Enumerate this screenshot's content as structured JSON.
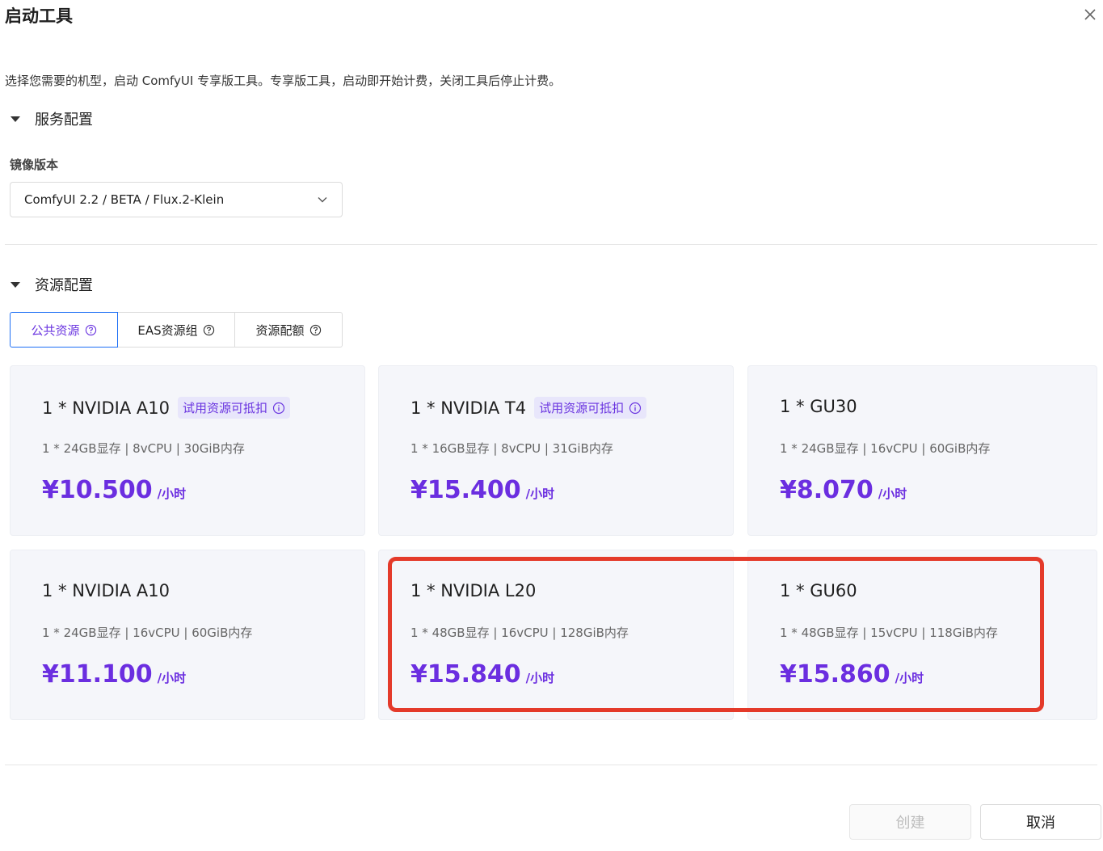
{
  "dialog": {
    "title": "启动工具",
    "description": "选择您需要的机型，启动 ComfyUI 专享版工具。专享版工具，启动即开始计费，关闭工具后停止计费。"
  },
  "service_config": {
    "header": "服务配置",
    "image_version_label": "镜像版本",
    "image_version_value": "ComfyUI 2.2 / BETA / Flux.2-Klein"
  },
  "resource_config": {
    "header": "资源配置",
    "tabs": [
      {
        "label": "公共资源",
        "active": true
      },
      {
        "label": "EAS资源组",
        "active": false
      },
      {
        "label": "资源配额",
        "active": false
      }
    ],
    "cards": [
      {
        "name": "1 * NVIDIA A10",
        "tag": "试用资源可抵扣",
        "spec": "1 * 24GB显存 | 8vCPU | 30GiB内存",
        "price": "¥10.500",
        "unit": "/小时"
      },
      {
        "name": "1 * NVIDIA T4",
        "tag": "试用资源可抵扣",
        "spec": "1 * 16GB显存 | 8vCPU | 31GiB内存",
        "price": "¥15.400",
        "unit": "/小时"
      },
      {
        "name": "1 * GU30",
        "tag": "",
        "spec": "1 * 24GB显存 | 16vCPU | 60GiB内存",
        "price": "¥8.070",
        "unit": "/小时"
      },
      {
        "name": "1 * NVIDIA A10",
        "tag": "",
        "spec": "1 * 24GB显存 | 16vCPU | 60GiB内存",
        "price": "¥11.100",
        "unit": "/小时"
      },
      {
        "name": "1 * NVIDIA L20",
        "tag": "",
        "spec": "1 * 48GB显存 | 16vCPU | 128GiB内存",
        "price": "¥15.840",
        "unit": "/小时"
      },
      {
        "name": "1 * GU60",
        "tag": "",
        "spec": "1 * 48GB显存 | 15vCPU | 118GiB内存",
        "price": "¥15.860",
        "unit": "/小时"
      }
    ]
  },
  "footer": {
    "create_label": "创建",
    "cancel_label": "取消"
  },
  "colors": {
    "accent": "#6b2ee0",
    "active_border": "#1d6ff5",
    "annotation": "#e43a2a"
  }
}
